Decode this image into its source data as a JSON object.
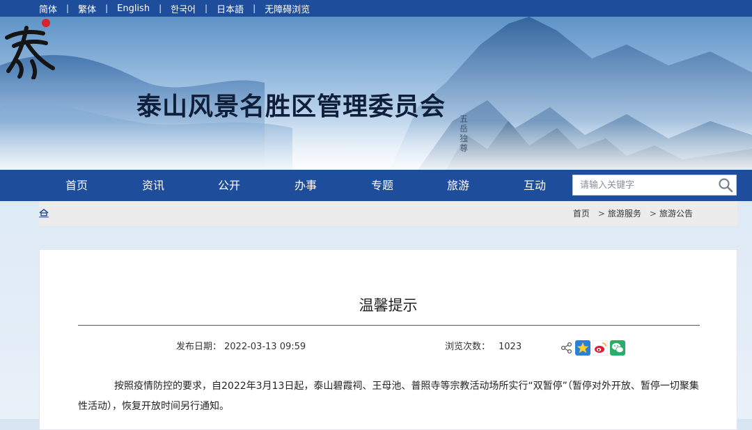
{
  "topbar": {
    "languages": [
      "简体",
      "繁体",
      "English",
      "한국어",
      "日本語",
      "无障碍浏览"
    ]
  },
  "banner": {
    "logo_char": "泰",
    "site_title": "泰山风景名胜区管理委员会",
    "vertical_inscription": "五岳独尊"
  },
  "nav": {
    "items": [
      "首页",
      "资讯",
      "公开",
      "办事",
      "专题",
      "旅游",
      "互动"
    ],
    "search_placeholder": "请输入关键字",
    "search_icon": "search-icon"
  },
  "breadcrumb": {
    "home_icon": "home-icon",
    "items": [
      "首页",
      "旅游服务",
      "旅游公告"
    ],
    "separator": ">"
  },
  "article": {
    "title": "温馨提示",
    "publish_label": "发布日期：",
    "publish_date": "2022-03-13 09:59",
    "views_label": "浏览次数：",
    "views": "1023",
    "share_icons": [
      "share-icon",
      "qzone-icon",
      "weibo-icon",
      "wechat-icon"
    ],
    "body": "按照疫情防控的要求，自2022年3月13日起，泰山碧霞祠、王母池、普照寺等宗教活动场所实行“双暂停”（暂停对外开放、暂停一切聚集性活动），恢复开放时间另行通知。"
  },
  "colors": {
    "nav_blue": "#1e4d9b",
    "breadcrumb_bg": "#ececec",
    "logo_red": "#d8232a"
  }
}
